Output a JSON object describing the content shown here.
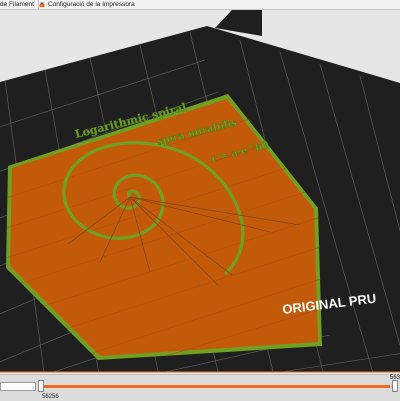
{
  "tabs": [
    {
      "label": "de Filament",
      "icon": "filament-settings-icon"
    },
    {
      "label": "Configuració de la Impressora",
      "icon": "printer-settings-icon"
    }
  ],
  "model": {
    "title": "Logarithmic spiral",
    "subtitle": "spira mirabilis",
    "formula": "r = a·e^bθ"
  },
  "bed": {
    "brand_text": "ORIGINAL PRU"
  },
  "layer_slider": {
    "low_value": "",
    "low_label": "56256",
    "high_label": "563",
    "position": 0.99
  },
  "colors": {
    "background": "#e6e6e6",
    "bed": "#1f1f1f",
    "grid": "#5a5a5a",
    "print": "#c25a0a",
    "perimeter": "#6fa022",
    "accent": "#ed6b21"
  }
}
